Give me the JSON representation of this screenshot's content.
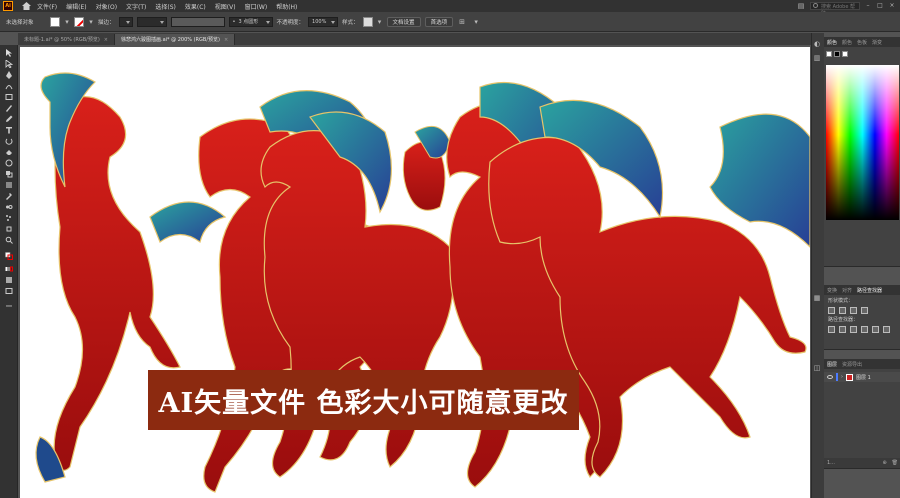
{
  "app": {
    "logo_text": "Ai"
  },
  "menu": [
    "文件(F)",
    "编辑(E)",
    "对象(O)",
    "文字(T)",
    "选择(S)",
    "效果(C)",
    "视图(V)",
    "窗口(W)",
    "帮助(H)"
  ],
  "search": {
    "placeholder": "搜索 Adobe 帮助"
  },
  "control_bar": {
    "selection_status": "未选择对象",
    "stroke_label": "描边：",
    "brush_value": "3 点圆形",
    "opacity_label": "不透明度：",
    "opacity_value": "100%",
    "style_label": "样式：",
    "doc_setup_button": "文档设置",
    "preferences_button": "首选项"
  },
  "tabs": [
    {
      "label": "未标题-1.ai* @ 50% (RGB/预览)",
      "close": "×"
    },
    {
      "label": "徐悲鸿六骏图插画.ai* @ 200% (RGB/预览)",
      "close": "×"
    }
  ],
  "artwork": {
    "banner_text": "AI矢量文件 色彩大小可随意更改",
    "colors": {
      "horse_red": "#c8140f",
      "horse_dark": "#8a0d0d",
      "mane_teal": "#1f8a8c",
      "mane_blue": "#1f3f8c",
      "gold": "#e6c46a",
      "banner_bg": "#8c2a10"
    }
  },
  "panels": {
    "color": {
      "tabs": [
        "颜色",
        "颜色",
        "色板",
        "渐变"
      ]
    },
    "pathfinder": {
      "tabs": [
        "变换",
        "对齐",
        "路径查找器"
      ],
      "shape_modes_label": "形状模式：",
      "pathfinders_label": "路径查找器："
    },
    "layers": {
      "tabs": [
        "图层",
        "资源导出"
      ],
      "layer_name": "图层 1",
      "footer_count": "1..."
    }
  }
}
